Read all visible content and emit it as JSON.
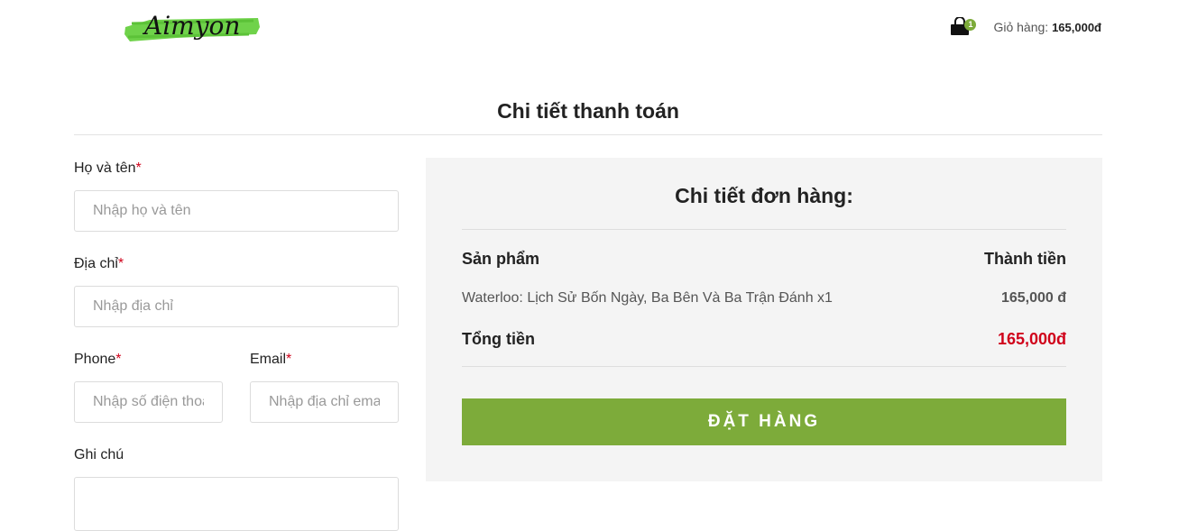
{
  "header": {
    "logo_text": "Aimyon",
    "cart_count": "1",
    "cart_label": "Giỏ hàng:",
    "cart_total": "165,000đ"
  },
  "page": {
    "title": "Chi tiết thanh toán"
  },
  "form": {
    "name_label": "Họ và tên",
    "name_placeholder": "Nhập họ và tên",
    "address_label": "Địa chỉ",
    "address_placeholder": "Nhập địa chỉ",
    "phone_label": "Phone",
    "phone_placeholder": "Nhập số điện thoại",
    "email_label": "Email",
    "email_placeholder": "Nhập địa chỉ email",
    "note_label": "Ghi chú",
    "required_mark": "*"
  },
  "order": {
    "title": "Chi tiết đơn hàng:",
    "col_product": "Sản phẩm",
    "col_total": "Thành tiền",
    "items": [
      {
        "name": "Waterloo: Lịch Sử Bốn Ngày, Ba Bên Và Ba Trận Đánh x1",
        "price": "165,000 đ"
      }
    ],
    "total_label": "Tổng tiền",
    "total_value": "165,000đ",
    "submit_label": "ĐẶT HÀNG"
  },
  "colors": {
    "accent": "#7dab3a",
    "price_red": "#d0021b",
    "panel_bg": "#f4f4f4"
  }
}
